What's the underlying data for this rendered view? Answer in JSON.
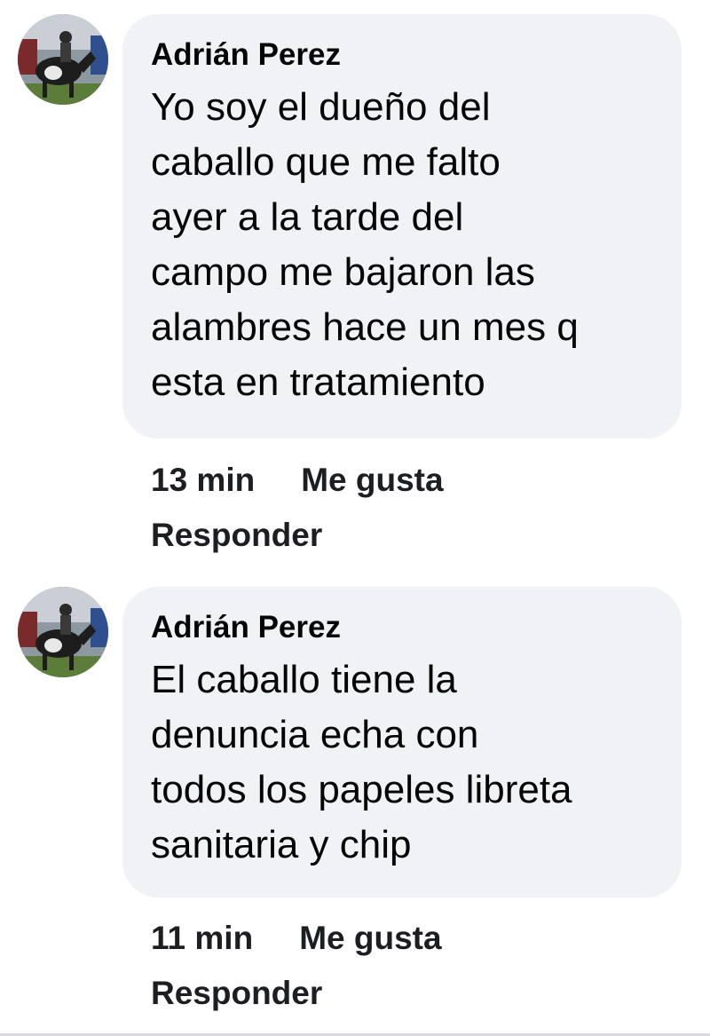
{
  "comments": [
    {
      "author": "Adrián Perez",
      "lines": [
        "Yo soy el dueño del",
        "caballo que me falto",
        "ayer a la tarde del",
        "campo me bajaron las",
        "alambres hace un mes q",
        "esta en tratamiento"
      ],
      "time": "13 min",
      "like_label": "Me gusta",
      "reply_label": "Responder"
    },
    {
      "author": "Adrián Perez",
      "lines": [
        "El caballo tiene la",
        "denuncia echa con",
        "todos los papeles libreta",
        "sanitaria y chip"
      ],
      "time": "11 min",
      "like_label": "Me gusta",
      "reply_label": "Responder"
    }
  ]
}
